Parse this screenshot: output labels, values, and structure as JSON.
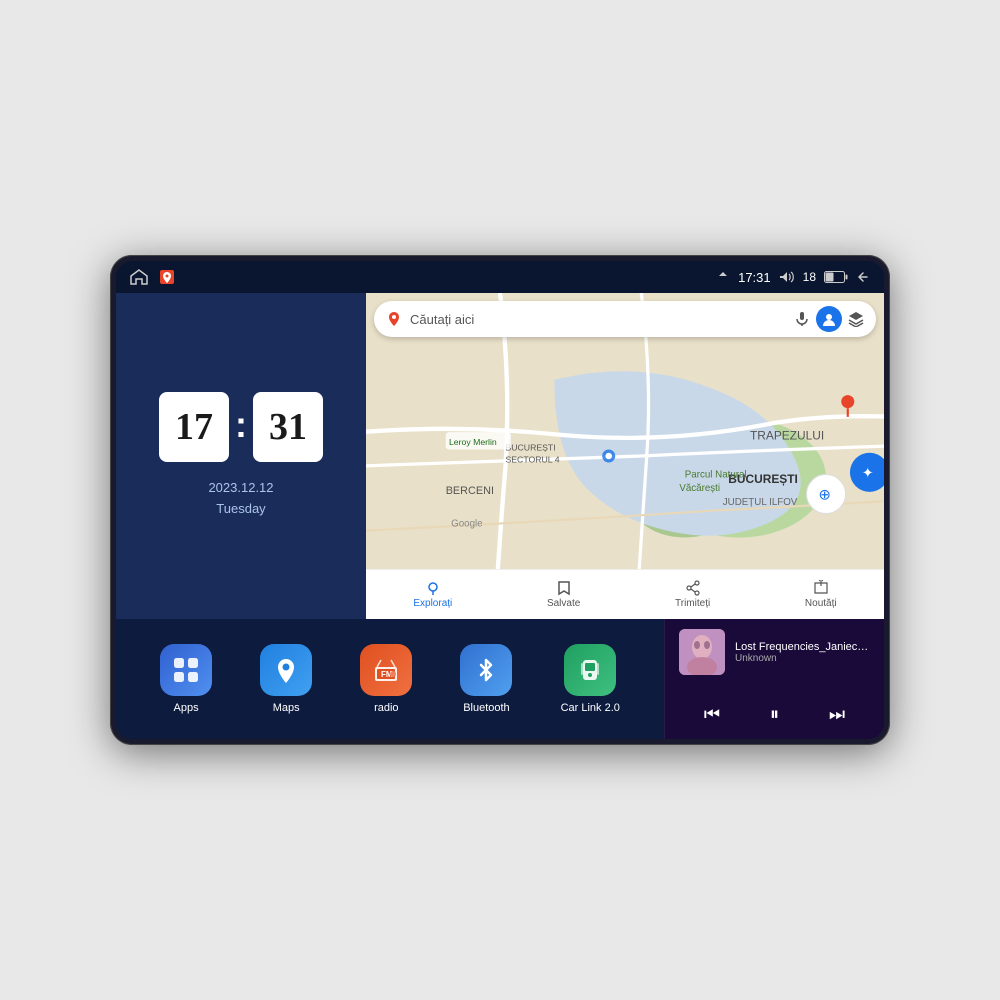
{
  "device": {
    "status_bar": {
      "time": "17:31",
      "battery": "18",
      "icons": [
        "home",
        "maps-pin",
        "signal",
        "volume",
        "battery",
        "back"
      ]
    },
    "clock": {
      "hour": "17",
      "minute": "31",
      "date": "2023.12.12",
      "day": "Tuesday"
    },
    "map": {
      "search_placeholder": "Căutați aici",
      "location": "București",
      "bottom_items": [
        {
          "label": "Explorați",
          "active": true
        },
        {
          "label": "Salvate",
          "active": false
        },
        {
          "label": "Trimiteți",
          "active": false
        },
        {
          "label": "Noutăți",
          "active": false
        }
      ]
    },
    "apps": [
      {
        "id": "apps",
        "label": "Apps",
        "icon": "⊞",
        "color_class": "icon-apps"
      },
      {
        "id": "maps",
        "label": "Maps",
        "icon": "📍",
        "color_class": "icon-maps"
      },
      {
        "id": "radio",
        "label": "radio",
        "icon": "📻",
        "color_class": "icon-radio"
      },
      {
        "id": "bluetooth",
        "label": "Bluetooth",
        "icon": "⬡",
        "color_class": "icon-bluetooth"
      },
      {
        "id": "carlink",
        "label": "Car Link 2.0",
        "icon": "📱",
        "color_class": "icon-carlink"
      }
    ],
    "music": {
      "title": "Lost Frequencies_Janieck Devy-...",
      "artist": "Unknown",
      "controls": {
        "prev": "⏮",
        "play_pause": "⏸",
        "next": "⏭"
      }
    }
  }
}
